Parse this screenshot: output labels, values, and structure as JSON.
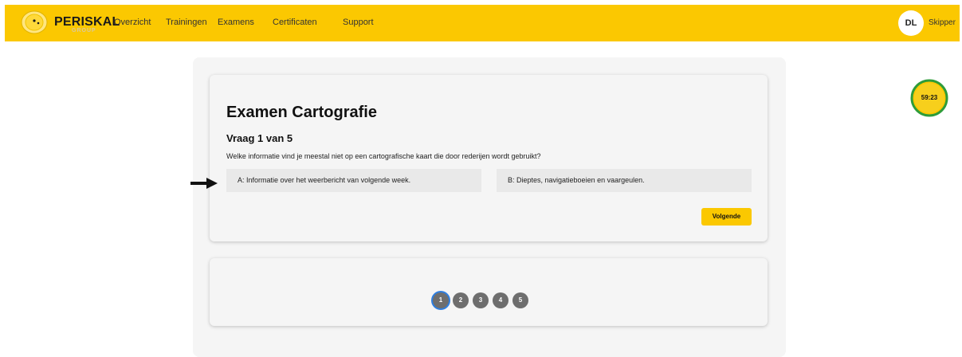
{
  "header": {
    "brand": "PERISKAL",
    "brand_sub": "GROUP",
    "nav": [
      "Overzicht",
      "Trainingen",
      "Examens",
      "Certificaten",
      "Support"
    ],
    "user_initials": "DL",
    "user_name": "Skipper"
  },
  "exam": {
    "title": "Examen Cartografie",
    "question_counter": "Vraag 1 van 5",
    "question": "Welke informatie vind je meestal niet op een cartografische kaart die door rederijen wordt gebruikt?",
    "options": [
      "A: Informatie over het weerbericht van volgende week.",
      "B: Dieptes, navigatieboeien en vaargeulen."
    ],
    "next_label": "Volgende"
  },
  "pagination": {
    "pages": [
      "1",
      "2",
      "3",
      "4",
      "5"
    ],
    "current": "1"
  },
  "timer": {
    "remaining": "59:23"
  },
  "colors": {
    "brand_yellow": "#FBC801",
    "timer_ring": "#2E9C3A",
    "active_page_ring": "#2F7FE0"
  },
  "icons": {
    "logo": "periskal-logo-icon",
    "pointer": "arrow-right-icon"
  }
}
